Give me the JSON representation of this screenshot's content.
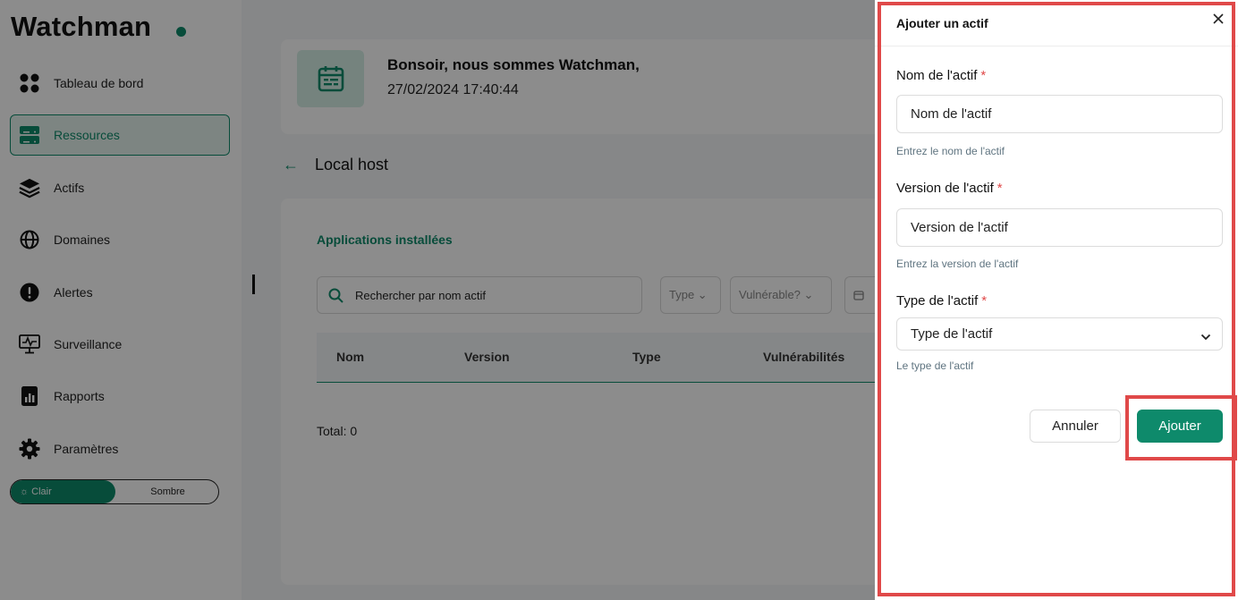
{
  "app": {
    "logo_text": "Watchman"
  },
  "sidebar": {
    "items": [
      {
        "label": "Tableau de bord",
        "icon": "dashboard-icon"
      },
      {
        "label": "Ressources",
        "icon": "server-icon",
        "active": true
      },
      {
        "label": "Actifs",
        "icon": "layers-icon"
      },
      {
        "label": "Domaines",
        "icon": "globe-icon"
      },
      {
        "label": "Alertes",
        "icon": "alert-icon"
      },
      {
        "label": "Surveillance",
        "icon": "monitor-icon"
      },
      {
        "label": "Rapports",
        "icon": "report-icon"
      },
      {
        "label": "Paramètres",
        "icon": "gear-icon"
      }
    ],
    "theme": {
      "light": "Clair",
      "dark": "Sombre",
      "selected": "light"
    }
  },
  "header": {
    "greeting": "Bonsoir, nous sommes Watchman,",
    "datetime": "27/02/2024 17:40:44"
  },
  "page": {
    "title": "Local host",
    "section_title": "Applications installées",
    "search_placeholder": "Rechercher par nom actif",
    "filters": {
      "type": "Type",
      "vulnerable": "Vulnérable?"
    },
    "table_headers": [
      "Nom",
      "Version",
      "Type",
      "Vulnérabilités"
    ],
    "total": "Total: 0"
  },
  "drawer": {
    "title": "Ajouter un actif",
    "name": {
      "label": "Nom de l'actif",
      "placeholder": "Nom de l'actif",
      "help": "Entrez le nom de l'actif"
    },
    "version": {
      "label": "Version de l'actif",
      "placeholder": "Version de l'actif",
      "help": "Entrez la version de l'actif"
    },
    "type": {
      "label": "Type de l'actif",
      "placeholder": "Type de l'actif",
      "help": "Le type de l'actif"
    },
    "required_mark": "*",
    "cancel_label": "Annuler",
    "add_label": "Ajouter"
  },
  "colors": {
    "accent": "#0e8a6b",
    "highlight": "#e04949",
    "overlay": "rgba(0,0,0,0.45)"
  }
}
